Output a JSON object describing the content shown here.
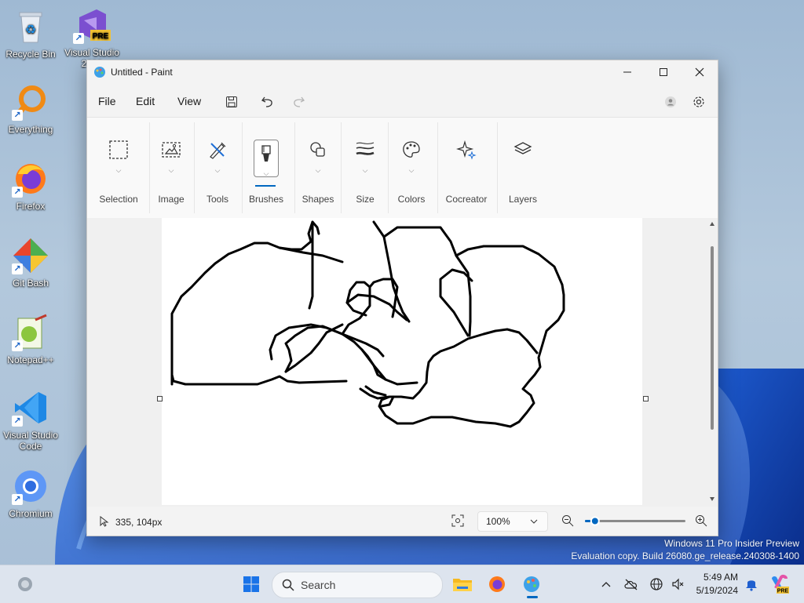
{
  "desktop": {
    "icons": [
      {
        "label": "Recycle Bin"
      },
      {
        "label": "Visual Studio 2022",
        "badge": "PRE"
      },
      {
        "label": "Everything"
      },
      {
        "label": "Firefox"
      },
      {
        "label": "Git Bash"
      },
      {
        "label": "Notepad++"
      },
      {
        "label": "Visual Studio Code"
      },
      {
        "label": "Chromium"
      }
    ]
  },
  "window": {
    "title": "Untitled - Paint",
    "menu": [
      "File",
      "Edit",
      "View"
    ],
    "ribbon": [
      {
        "label": "Selection",
        "icon": "selection-icon"
      },
      {
        "label": "Image",
        "icon": "image-icon"
      },
      {
        "label": "Tools",
        "icon": "tools-icon"
      },
      {
        "label": "Brushes",
        "icon": "brush-icon"
      },
      {
        "label": "Shapes",
        "icon": "shapes-icon"
      },
      {
        "label": "Size",
        "icon": "size-icon"
      },
      {
        "label": "Colors",
        "icon": "palette-icon"
      },
      {
        "label": "Cocreator",
        "icon": "sparkle-icon"
      },
      {
        "label": "Layers",
        "icon": "layers-icon"
      }
    ],
    "status": {
      "coords": "335, 104px",
      "zoom": "100%",
      "zoom_level": 0.1
    }
  },
  "watermark": {
    "line1": "Windows 11 Pro Insider Preview",
    "line2": "Evaluation copy. Build 26080.ge_release.240308-1400"
  },
  "taskbar": {
    "search_placeholder": "Search",
    "time": "5:49 AM",
    "date": "5/19/2024",
    "copilot_badge": "PRE"
  },
  "colors": {
    "accent": "#0067c0",
    "ink": "#000000"
  }
}
